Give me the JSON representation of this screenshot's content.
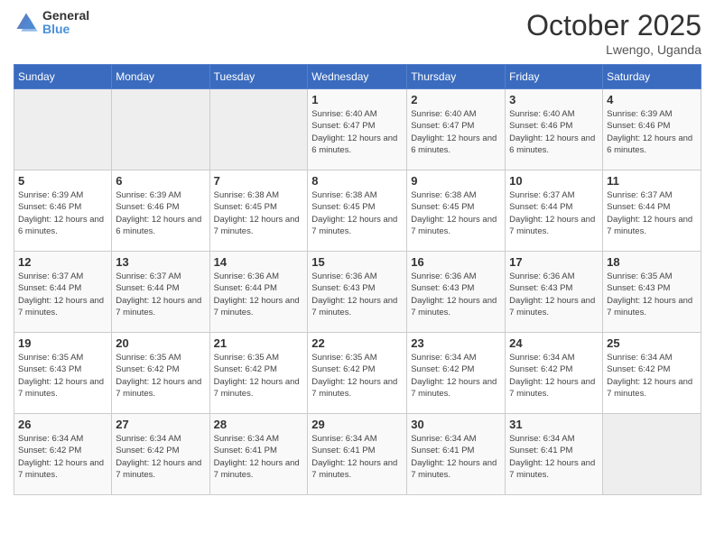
{
  "header": {
    "logo_general": "General",
    "logo_blue": "Blue",
    "month": "October 2025",
    "location": "Lwengo, Uganda"
  },
  "days_of_week": [
    "Sunday",
    "Monday",
    "Tuesday",
    "Wednesday",
    "Thursday",
    "Friday",
    "Saturday"
  ],
  "weeks": [
    [
      {
        "day": "",
        "sunrise": "",
        "sunset": "",
        "daylight": ""
      },
      {
        "day": "",
        "sunrise": "",
        "sunset": "",
        "daylight": ""
      },
      {
        "day": "",
        "sunrise": "",
        "sunset": "",
        "daylight": ""
      },
      {
        "day": "1",
        "sunrise": "Sunrise: 6:40 AM",
        "sunset": "Sunset: 6:47 PM",
        "daylight": "Daylight: 12 hours and 6 minutes."
      },
      {
        "day": "2",
        "sunrise": "Sunrise: 6:40 AM",
        "sunset": "Sunset: 6:47 PM",
        "daylight": "Daylight: 12 hours and 6 minutes."
      },
      {
        "day": "3",
        "sunrise": "Sunrise: 6:40 AM",
        "sunset": "Sunset: 6:46 PM",
        "daylight": "Daylight: 12 hours and 6 minutes."
      },
      {
        "day": "4",
        "sunrise": "Sunrise: 6:39 AM",
        "sunset": "Sunset: 6:46 PM",
        "daylight": "Daylight: 12 hours and 6 minutes."
      }
    ],
    [
      {
        "day": "5",
        "sunrise": "Sunrise: 6:39 AM",
        "sunset": "Sunset: 6:46 PM",
        "daylight": "Daylight: 12 hours and 6 minutes."
      },
      {
        "day": "6",
        "sunrise": "Sunrise: 6:39 AM",
        "sunset": "Sunset: 6:46 PM",
        "daylight": "Daylight: 12 hours and 6 minutes."
      },
      {
        "day": "7",
        "sunrise": "Sunrise: 6:38 AM",
        "sunset": "Sunset: 6:45 PM",
        "daylight": "Daylight: 12 hours and 7 minutes."
      },
      {
        "day": "8",
        "sunrise": "Sunrise: 6:38 AM",
        "sunset": "Sunset: 6:45 PM",
        "daylight": "Daylight: 12 hours and 7 minutes."
      },
      {
        "day": "9",
        "sunrise": "Sunrise: 6:38 AM",
        "sunset": "Sunset: 6:45 PM",
        "daylight": "Daylight: 12 hours and 7 minutes."
      },
      {
        "day": "10",
        "sunrise": "Sunrise: 6:37 AM",
        "sunset": "Sunset: 6:44 PM",
        "daylight": "Daylight: 12 hours and 7 minutes."
      },
      {
        "day": "11",
        "sunrise": "Sunrise: 6:37 AM",
        "sunset": "Sunset: 6:44 PM",
        "daylight": "Daylight: 12 hours and 7 minutes."
      }
    ],
    [
      {
        "day": "12",
        "sunrise": "Sunrise: 6:37 AM",
        "sunset": "Sunset: 6:44 PM",
        "daylight": "Daylight: 12 hours and 7 minutes."
      },
      {
        "day": "13",
        "sunrise": "Sunrise: 6:37 AM",
        "sunset": "Sunset: 6:44 PM",
        "daylight": "Daylight: 12 hours and 7 minutes."
      },
      {
        "day": "14",
        "sunrise": "Sunrise: 6:36 AM",
        "sunset": "Sunset: 6:44 PM",
        "daylight": "Daylight: 12 hours and 7 minutes."
      },
      {
        "day": "15",
        "sunrise": "Sunrise: 6:36 AM",
        "sunset": "Sunset: 6:43 PM",
        "daylight": "Daylight: 12 hours and 7 minutes."
      },
      {
        "day": "16",
        "sunrise": "Sunrise: 6:36 AM",
        "sunset": "Sunset: 6:43 PM",
        "daylight": "Daylight: 12 hours and 7 minutes."
      },
      {
        "day": "17",
        "sunrise": "Sunrise: 6:36 AM",
        "sunset": "Sunset: 6:43 PM",
        "daylight": "Daylight: 12 hours and 7 minutes."
      },
      {
        "day": "18",
        "sunrise": "Sunrise: 6:35 AM",
        "sunset": "Sunset: 6:43 PM",
        "daylight": "Daylight: 12 hours and 7 minutes."
      }
    ],
    [
      {
        "day": "19",
        "sunrise": "Sunrise: 6:35 AM",
        "sunset": "Sunset: 6:43 PM",
        "daylight": "Daylight: 12 hours and 7 minutes."
      },
      {
        "day": "20",
        "sunrise": "Sunrise: 6:35 AM",
        "sunset": "Sunset: 6:42 PM",
        "daylight": "Daylight: 12 hours and 7 minutes."
      },
      {
        "day": "21",
        "sunrise": "Sunrise: 6:35 AM",
        "sunset": "Sunset: 6:42 PM",
        "daylight": "Daylight: 12 hours and 7 minutes."
      },
      {
        "day": "22",
        "sunrise": "Sunrise: 6:35 AM",
        "sunset": "Sunset: 6:42 PM",
        "daylight": "Daylight: 12 hours and 7 minutes."
      },
      {
        "day": "23",
        "sunrise": "Sunrise: 6:34 AM",
        "sunset": "Sunset: 6:42 PM",
        "daylight": "Daylight: 12 hours and 7 minutes."
      },
      {
        "day": "24",
        "sunrise": "Sunrise: 6:34 AM",
        "sunset": "Sunset: 6:42 PM",
        "daylight": "Daylight: 12 hours and 7 minutes."
      },
      {
        "day": "25",
        "sunrise": "Sunrise: 6:34 AM",
        "sunset": "Sunset: 6:42 PM",
        "daylight": "Daylight: 12 hours and 7 minutes."
      }
    ],
    [
      {
        "day": "26",
        "sunrise": "Sunrise: 6:34 AM",
        "sunset": "Sunset: 6:42 PM",
        "daylight": "Daylight: 12 hours and 7 minutes."
      },
      {
        "day": "27",
        "sunrise": "Sunrise: 6:34 AM",
        "sunset": "Sunset: 6:42 PM",
        "daylight": "Daylight: 12 hours and 7 minutes."
      },
      {
        "day": "28",
        "sunrise": "Sunrise: 6:34 AM",
        "sunset": "Sunset: 6:41 PM",
        "daylight": "Daylight: 12 hours and 7 minutes."
      },
      {
        "day": "29",
        "sunrise": "Sunrise: 6:34 AM",
        "sunset": "Sunset: 6:41 PM",
        "daylight": "Daylight: 12 hours and 7 minutes."
      },
      {
        "day": "30",
        "sunrise": "Sunrise: 6:34 AM",
        "sunset": "Sunset: 6:41 PM",
        "daylight": "Daylight: 12 hours and 7 minutes."
      },
      {
        "day": "31",
        "sunrise": "Sunrise: 6:34 AM",
        "sunset": "Sunset: 6:41 PM",
        "daylight": "Daylight: 12 hours and 7 minutes."
      },
      {
        "day": "",
        "sunrise": "",
        "sunset": "",
        "daylight": ""
      }
    ]
  ]
}
